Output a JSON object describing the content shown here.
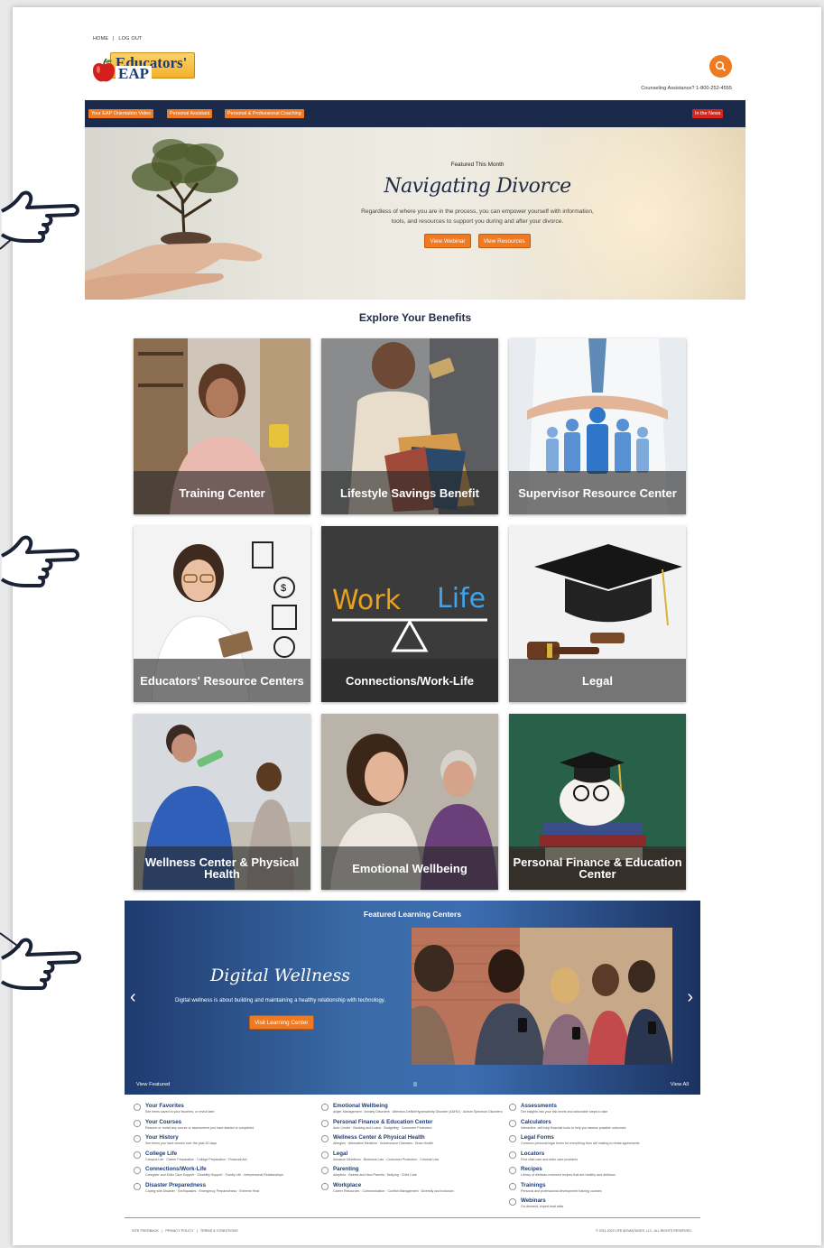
{
  "topnav": {
    "home": "HOME",
    "sep": "|",
    "logout": "LOG OUT"
  },
  "logo": {
    "word": "Educators'",
    "eap": "EAP"
  },
  "counseling": "Counseling Assistance? 1-800-252-4555",
  "navbar": {
    "items": [
      "Your EAP Orientation Video",
      "Personal Assistant",
      "Personal & Professional Coaching"
    ],
    "news": "In the News"
  },
  "hero": {
    "label": "Featured This Month",
    "title": "Navigating Divorce",
    "description": "Regardless of where you are in the process, you can empower yourself with information, tools, and resources to support you during and after your divorce.",
    "buttons": [
      "View Webinar",
      "View Resources"
    ]
  },
  "benefits": {
    "title": "Explore Your Benefits",
    "tiles": [
      "Training Center",
      "Lifestyle Savings Benefit",
      "Supervisor Resource Center",
      "Educators' Resource Centers",
      "Connections/Work-Life",
      "Legal",
      "Wellness Center & Physical Health",
      "Emotional Wellbeing",
      "Personal Finance & Education Center"
    ],
    "work_word": "Work",
    "life_word": "Life"
  },
  "featured_learning": {
    "title": "Featured Learning Centers",
    "heading": "Digital Wellness",
    "description": "Digital wellness is about building and maintaining a healthy relationship with technology.",
    "button": "Visit Learning Center",
    "view_featured": "View Featured",
    "pause": "II",
    "view_all": "View All",
    "prev": "‹",
    "next": "›"
  },
  "links": [
    {
      "title": "Your Favorites",
      "desc": "See items saved to your favorites, or revisit later",
      "icon": "star-icon"
    },
    {
      "title": "Your Courses",
      "desc": "Resume or revisit any course or assessment you have started or completed",
      "icon": "course-icon"
    },
    {
      "title": "Your History",
      "desc": "See items you have viewed over the past 30 days",
      "icon": "history-icon"
    },
    {
      "title": "College Life",
      "desc": "Campus Life · Career Preparation · College Preparation · Financial Aid",
      "icon": "college-icon"
    },
    {
      "title": "Connections/Work-Life",
      "desc": "Caregiver and Elder Care Support · Disability Support · Family Life · Interpersonal Relationships",
      "icon": "connections-icon"
    },
    {
      "title": "Disaster Preparedness",
      "desc": "Coping with Disaster · Earthquakes · Emergency Preparedness · Extreme Heat",
      "icon": "disaster-icon"
    },
    {
      "title": "Emotional Wellbeing",
      "desc": "Anger Management · Anxiety Disorders · Attention-Deficit/Hyperactivity Disorder (ADHD) · Autism Spectrum Disorders",
      "icon": "emotional-icon"
    },
    {
      "title": "Personal Finance & Education Center",
      "desc": "Auto Center · Banking and Loans · Budgeting · Consumer Protection",
      "icon": "finance-icon"
    },
    {
      "title": "Wellness Center & Physical Health",
      "desc": "Allergies · Alternative Medicine · Autoimmune Diseases · Brain Health",
      "icon": "wellness-icon"
    },
    {
      "title": "Legal",
      "desc": "Advance Directives · Business Law · Consumer Protection · Criminal Law",
      "icon": "legal-icon"
    },
    {
      "title": "Parenting",
      "desc": "Adoption · Babies and New Parents · Bullying · Child Care",
      "icon": "parenting-icon"
    },
    {
      "title": "Workplace",
      "desc": "Career Resources · Communication · Conflict Management · Diversity and Inclusion",
      "icon": "workplace-icon"
    },
    {
      "title": "Assessments",
      "desc": "Get insights into your risk levels and actionable steps to take",
      "icon": "assessment-icon"
    },
    {
      "title": "Calculators",
      "desc": "Interactive, self-help financial tools to help you assess possible outcomes",
      "icon": "calculator-icon"
    },
    {
      "title": "Legal Forms",
      "desc": "Common personal legal forms for everything from will making to rental agreements",
      "icon": "legal-forms-icon"
    },
    {
      "title": "Locators",
      "desc": "Find child care and elder care providers",
      "icon": "locator-icon"
    },
    {
      "title": "Recipes",
      "desc": "Library of dietician-reviewed recipes that are healthy and delicious",
      "icon": "recipe-icon"
    },
    {
      "title": "Trainings",
      "desc": "Personal and professional development training courses",
      "icon": "training-icon"
    },
    {
      "title": "Webinars",
      "desc": "On-demand, expert-lead talks",
      "icon": "webinar-icon"
    }
  ],
  "footer": {
    "links": [
      "SITE FEEDBACK",
      "PRIVACY POLICY",
      "TERMS & CONDITIONS"
    ],
    "sep": "|",
    "copyright": "© 2011-2022 LIFE ADVANTAGES, LLC. ALL RIGHTS RESERVED."
  },
  "colors": {
    "accent": "#ef7a22",
    "navy": "#1b2a4a",
    "news": "#d9261c",
    "banner": "#3a6aa6"
  }
}
